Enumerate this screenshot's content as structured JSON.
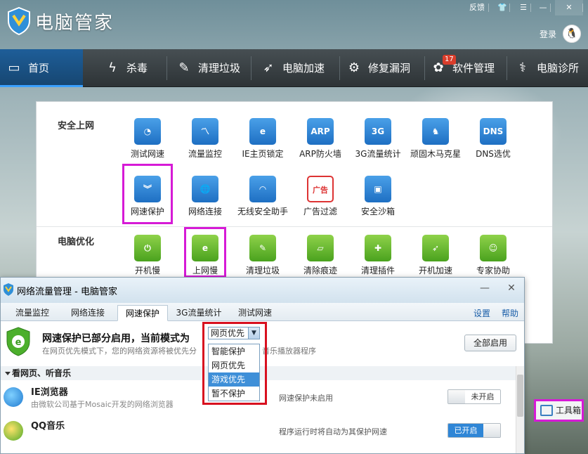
{
  "app": {
    "title": "电脑管家",
    "login": "登录",
    "window_controls": {
      "feedback": "反馈"
    }
  },
  "nav": {
    "items": [
      {
        "label": "首页",
        "icon": "monitor-icon",
        "active": true
      },
      {
        "label": "杀毒",
        "icon": "lightning-icon"
      },
      {
        "label": "清理垃圾",
        "icon": "broom-icon"
      },
      {
        "label": "电脑加速",
        "icon": "rocket-icon"
      },
      {
        "label": "修复漏洞",
        "icon": "gear-icon"
      },
      {
        "label": "软件管理",
        "icon": "flower-icon",
        "badge": "17"
      },
      {
        "label": "电脑诊所",
        "icon": "stethoscope-icon"
      }
    ]
  },
  "toolbox_panel": {
    "section_internet": "安全上网",
    "section_optimize": "电脑优化",
    "tools_row1": [
      "测试网速",
      "流量监控",
      "IE主页锁定",
      "ARP防火墙",
      "3G流量统计",
      "顽固木马克星",
      "DNS选优"
    ],
    "tools_row2": [
      "网速保护",
      "网络连接",
      "无线安全助手",
      "广告过滤",
      "安全沙箱"
    ],
    "tools_row3": [
      "开机慢",
      "上网慢",
      "清理垃圾",
      "清除痕迹",
      "清理插件",
      "开机加速",
      "专家协助"
    ],
    "icon_text": {
      "arp": "ARP",
      "3g": "3G",
      "dns": "DNS",
      "ad": "广告"
    }
  },
  "dialog": {
    "title": "网络流量管理 - 电脑管家",
    "tabs": [
      "流量监控",
      "网络连接",
      "网速保护",
      "3G流量统计",
      "测试网速"
    ],
    "active_tab": "网速保护",
    "links": {
      "settings": "设置",
      "help": "帮助"
    },
    "status_title": "网速保护已部分启用，当前模式为",
    "status_desc": "在网页优先模式下，您的网络资源将被优先分",
    "status_desc_tail": "音乐播放器程序",
    "mode_value": "网页优先",
    "mode_options": [
      "智能保护",
      "网页优先",
      "游戏优先",
      "暂不保护"
    ],
    "mode_highlighted": "游戏优先",
    "enable_all": "全部启用",
    "group_label": "看网页、听音乐",
    "apps": [
      {
        "name": "IE浏览器",
        "desc": "由微软公司基于Mosaic开发的网络浏览器",
        "status": "网速保护未启用",
        "toggle": "未开启",
        "on": false
      },
      {
        "name": "QQ音乐",
        "desc": "",
        "status": "程序运行时将自动为其保护网速",
        "toggle": "已开启",
        "on": true
      }
    ]
  },
  "toolbox_button": {
    "label": "工具箱"
  },
  "colors": {
    "accent": "#1e6fc3",
    "highlight": "#d61ad6",
    "annotation_red": "#d8101f",
    "toggle_on": "#2f86d6"
  }
}
